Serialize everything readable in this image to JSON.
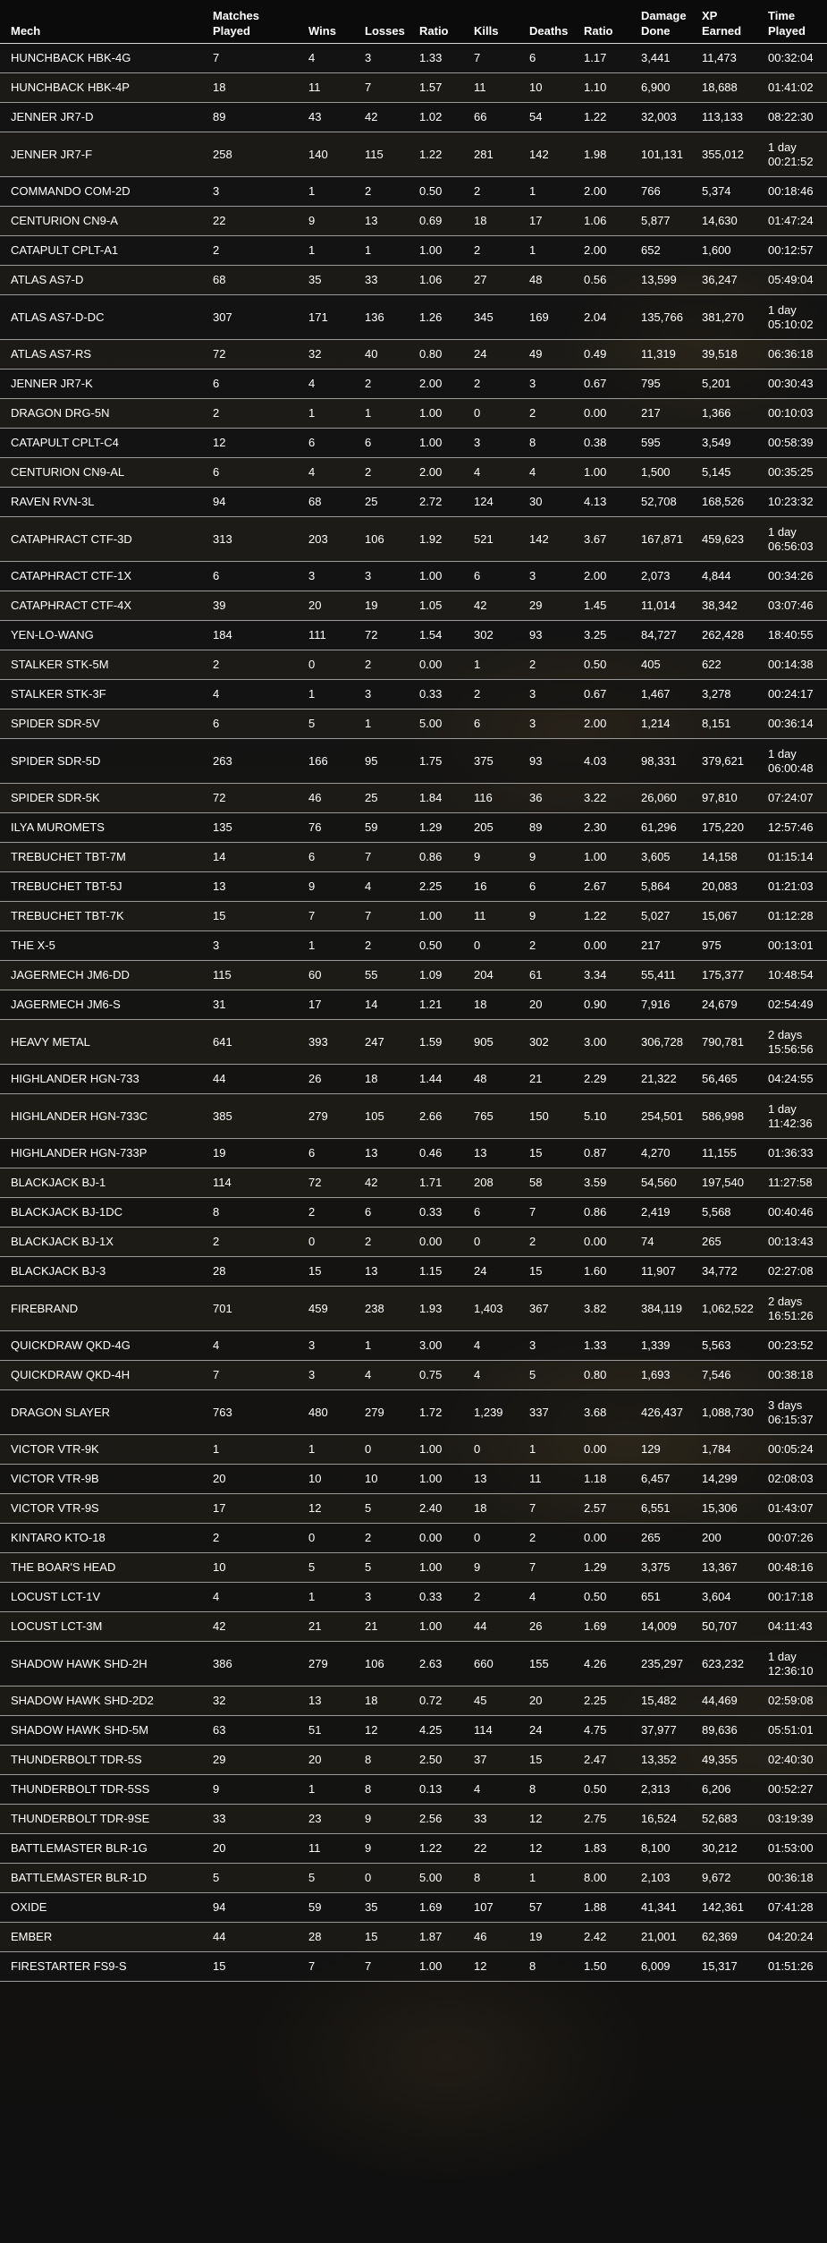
{
  "columns": [
    "Mech",
    "Matches\nPlayed",
    "Wins",
    "Losses",
    "Ratio",
    "Kills",
    "Deaths",
    "Ratio",
    "Damage\nDone",
    "XP\nEarned",
    "Time\nPlayed"
  ],
  "rows": [
    [
      "HUNCHBACK HBK-4G",
      "7",
      "4",
      "3",
      "1.33",
      "7",
      "6",
      "1.17",
      "3,441",
      "11,473",
      "00:32:04"
    ],
    [
      "HUNCHBACK HBK-4P",
      "18",
      "11",
      "7",
      "1.57",
      "11",
      "10",
      "1.10",
      "6,900",
      "18,688",
      "01:41:02"
    ],
    [
      "JENNER JR7-D",
      "89",
      "43",
      "42",
      "1.02",
      "66",
      "54",
      "1.22",
      "32,003",
      "113,133",
      "08:22:30"
    ],
    [
      "JENNER JR7-F",
      "258",
      "140",
      "115",
      "1.22",
      "281",
      "142",
      "1.98",
      "101,131",
      "355,012",
      "1 day 00:21:52"
    ],
    [
      "COMMANDO COM-2D",
      "3",
      "1",
      "2",
      "0.50",
      "2",
      "1",
      "2.00",
      "766",
      "5,374",
      "00:18:46"
    ],
    [
      "CENTURION CN9-A",
      "22",
      "9",
      "13",
      "0.69",
      "18",
      "17",
      "1.06",
      "5,877",
      "14,630",
      "01:47:24"
    ],
    [
      "CATAPULT CPLT-A1",
      "2",
      "1",
      "1",
      "1.00",
      "2",
      "1",
      "2.00",
      "652",
      "1,600",
      "00:12:57"
    ],
    [
      "ATLAS AS7-D",
      "68",
      "35",
      "33",
      "1.06",
      "27",
      "48",
      "0.56",
      "13,599",
      "36,247",
      "05:49:04"
    ],
    [
      "ATLAS AS7-D-DC",
      "307",
      "171",
      "136",
      "1.26",
      "345",
      "169",
      "2.04",
      "135,766",
      "381,270",
      "1 day 05:10:02"
    ],
    [
      "ATLAS AS7-RS",
      "72",
      "32",
      "40",
      "0.80",
      "24",
      "49",
      "0.49",
      "11,319",
      "39,518",
      "06:36:18"
    ],
    [
      "JENNER JR7-K",
      "6",
      "4",
      "2",
      "2.00",
      "2",
      "3",
      "0.67",
      "795",
      "5,201",
      "00:30:43"
    ],
    [
      "DRAGON DRG-5N",
      "2",
      "1",
      "1",
      "1.00",
      "0",
      "2",
      "0.00",
      "217",
      "1,366",
      "00:10:03"
    ],
    [
      "CATAPULT CPLT-C4",
      "12",
      "6",
      "6",
      "1.00",
      "3",
      "8",
      "0.38",
      "595",
      "3,549",
      "00:58:39"
    ],
    [
      "CENTURION CN9-AL",
      "6",
      "4",
      "2",
      "2.00",
      "4",
      "4",
      "1.00",
      "1,500",
      "5,145",
      "00:35:25"
    ],
    [
      "RAVEN RVN-3L",
      "94",
      "68",
      "25",
      "2.72",
      "124",
      "30",
      "4.13",
      "52,708",
      "168,526",
      "10:23:32"
    ],
    [
      "CATAPHRACT CTF-3D",
      "313",
      "203",
      "106",
      "1.92",
      "521",
      "142",
      "3.67",
      "167,871",
      "459,623",
      "1 day 06:56:03"
    ],
    [
      "CATAPHRACT CTF-1X",
      "6",
      "3",
      "3",
      "1.00",
      "6",
      "3",
      "2.00",
      "2,073",
      "4,844",
      "00:34:26"
    ],
    [
      "CATAPHRACT CTF-4X",
      "39",
      "20",
      "19",
      "1.05",
      "42",
      "29",
      "1.45",
      "11,014",
      "38,342",
      "03:07:46"
    ],
    [
      "YEN-LO-WANG",
      "184",
      "111",
      "72",
      "1.54",
      "302",
      "93",
      "3.25",
      "84,727",
      "262,428",
      "18:40:55"
    ],
    [
      "STALKER STK-5M",
      "2",
      "0",
      "2",
      "0.00",
      "1",
      "2",
      "0.50",
      "405",
      "622",
      "00:14:38"
    ],
    [
      "STALKER STK-3F",
      "4",
      "1",
      "3",
      "0.33",
      "2",
      "3",
      "0.67",
      "1,467",
      "3,278",
      "00:24:17"
    ],
    [
      "SPIDER SDR-5V",
      "6",
      "5",
      "1",
      "5.00",
      "6",
      "3",
      "2.00",
      "1,214",
      "8,151",
      "00:36:14"
    ],
    [
      "SPIDER SDR-5D",
      "263",
      "166",
      "95",
      "1.75",
      "375",
      "93",
      "4.03",
      "98,331",
      "379,621",
      "1 day 06:00:48"
    ],
    [
      "SPIDER SDR-5K",
      "72",
      "46",
      "25",
      "1.84",
      "116",
      "36",
      "3.22",
      "26,060",
      "97,810",
      "07:24:07"
    ],
    [
      "ILYA MUROMETS",
      "135",
      "76",
      "59",
      "1.29",
      "205",
      "89",
      "2.30",
      "61,296",
      "175,220",
      "12:57:46"
    ],
    [
      "TREBUCHET TBT-7M",
      "14",
      "6",
      "7",
      "0.86",
      "9",
      "9",
      "1.00",
      "3,605",
      "14,158",
      "01:15:14"
    ],
    [
      "TREBUCHET TBT-5J",
      "13",
      "9",
      "4",
      "2.25",
      "16",
      "6",
      "2.67",
      "5,864",
      "20,083",
      "01:21:03"
    ],
    [
      "TREBUCHET TBT-7K",
      "15",
      "7",
      "7",
      "1.00",
      "11",
      "9",
      "1.22",
      "5,027",
      "15,067",
      "01:12:28"
    ],
    [
      "THE X-5",
      "3",
      "1",
      "2",
      "0.50",
      "0",
      "2",
      "0.00",
      "217",
      "975",
      "00:13:01"
    ],
    [
      "JAGERMECH JM6-DD",
      "115",
      "60",
      "55",
      "1.09",
      "204",
      "61",
      "3.34",
      "55,411",
      "175,377",
      "10:48:54"
    ],
    [
      "JAGERMECH JM6-S",
      "31",
      "17",
      "14",
      "1.21",
      "18",
      "20",
      "0.90",
      "7,916",
      "24,679",
      "02:54:49"
    ],
    [
      "HEAVY METAL",
      "641",
      "393",
      "247",
      "1.59",
      "905",
      "302",
      "3.00",
      "306,728",
      "790,781",
      "2 days 15:56:56"
    ],
    [
      "HIGHLANDER HGN-733",
      "44",
      "26",
      "18",
      "1.44",
      "48",
      "21",
      "2.29",
      "21,322",
      "56,465",
      "04:24:55"
    ],
    [
      "HIGHLANDER HGN-733C",
      "385",
      "279",
      "105",
      "2.66",
      "765",
      "150",
      "5.10",
      "254,501",
      "586,998",
      "1 day 11:42:36"
    ],
    [
      "HIGHLANDER HGN-733P",
      "19",
      "6",
      "13",
      "0.46",
      "13",
      "15",
      "0.87",
      "4,270",
      "11,155",
      "01:36:33"
    ],
    [
      "BLACKJACK BJ-1",
      "114",
      "72",
      "42",
      "1.71",
      "208",
      "58",
      "3.59",
      "54,560",
      "197,540",
      "11:27:58"
    ],
    [
      "BLACKJACK BJ-1DC",
      "8",
      "2",
      "6",
      "0.33",
      "6",
      "7",
      "0.86",
      "2,419",
      "5,568",
      "00:40:46"
    ],
    [
      "BLACKJACK BJ-1X",
      "2",
      "0",
      "2",
      "0.00",
      "0",
      "2",
      "0.00",
      "74",
      "265",
      "00:13:43"
    ],
    [
      "BLACKJACK BJ-3",
      "28",
      "15",
      "13",
      "1.15",
      "24",
      "15",
      "1.60",
      "11,907",
      "34,772",
      "02:27:08"
    ],
    [
      "FIREBRAND",
      "701",
      "459",
      "238",
      "1.93",
      "1,403",
      "367",
      "3.82",
      "384,119",
      "1,062,522",
      "2 days 16:51:26"
    ],
    [
      "QUICKDRAW QKD-4G",
      "4",
      "3",
      "1",
      "3.00",
      "4",
      "3",
      "1.33",
      "1,339",
      "5,563",
      "00:23:52"
    ],
    [
      "QUICKDRAW QKD-4H",
      "7",
      "3",
      "4",
      "0.75",
      "4",
      "5",
      "0.80",
      "1,693",
      "7,546",
      "00:38:18"
    ],
    [
      "DRAGON SLAYER",
      "763",
      "480",
      "279",
      "1.72",
      "1,239",
      "337",
      "3.68",
      "426,437",
      "1,088,730",
      "3 days 06:15:37"
    ],
    [
      "VICTOR VTR-9K",
      "1",
      "1",
      "0",
      "1.00",
      "0",
      "1",
      "0.00",
      "129",
      "1,784",
      "00:05:24"
    ],
    [
      "VICTOR VTR-9B",
      "20",
      "10",
      "10",
      "1.00",
      "13",
      "11",
      "1.18",
      "6,457",
      "14,299",
      "02:08:03"
    ],
    [
      "VICTOR VTR-9S",
      "17",
      "12",
      "5",
      "2.40",
      "18",
      "7",
      "2.57",
      "6,551",
      "15,306",
      "01:43:07"
    ],
    [
      "KINTARO KTO-18",
      "2",
      "0",
      "2",
      "0.00",
      "0",
      "2",
      "0.00",
      "265",
      "200",
      "00:07:26"
    ],
    [
      "THE BOAR'S HEAD",
      "10",
      "5",
      "5",
      "1.00",
      "9",
      "7",
      "1.29",
      "3,375",
      "13,367",
      "00:48:16"
    ],
    [
      "LOCUST LCT-1V",
      "4",
      "1",
      "3",
      "0.33",
      "2",
      "4",
      "0.50",
      "651",
      "3,604",
      "00:17:18"
    ],
    [
      "LOCUST LCT-3M",
      "42",
      "21",
      "21",
      "1.00",
      "44",
      "26",
      "1.69",
      "14,009",
      "50,707",
      "04:11:43"
    ],
    [
      "SHADOW HAWK SHD-2H",
      "386",
      "279",
      "106",
      "2.63",
      "660",
      "155",
      "4.26",
      "235,297",
      "623,232",
      "1 day 12:36:10"
    ],
    [
      "SHADOW HAWK SHD-2D2",
      "32",
      "13",
      "18",
      "0.72",
      "45",
      "20",
      "2.25",
      "15,482",
      "44,469",
      "02:59:08"
    ],
    [
      "SHADOW HAWK SHD-5M",
      "63",
      "51",
      "12",
      "4.25",
      "114",
      "24",
      "4.75",
      "37,977",
      "89,636",
      "05:51:01"
    ],
    [
      "THUNDERBOLT TDR-5S",
      "29",
      "20",
      "8",
      "2.50",
      "37",
      "15",
      "2.47",
      "13,352",
      "49,355",
      "02:40:30"
    ],
    [
      "THUNDERBOLT TDR-5SS",
      "9",
      "1",
      "8",
      "0.13",
      "4",
      "8",
      "0.50",
      "2,313",
      "6,206",
      "00:52:27"
    ],
    [
      "THUNDERBOLT TDR-9SE",
      "33",
      "23",
      "9",
      "2.56",
      "33",
      "12",
      "2.75",
      "16,524",
      "52,683",
      "03:19:39"
    ],
    [
      "BATTLEMASTER BLR-1G",
      "20",
      "11",
      "9",
      "1.22",
      "22",
      "12",
      "1.83",
      "8,100",
      "30,212",
      "01:53:00"
    ],
    [
      "BATTLEMASTER BLR-1D",
      "5",
      "5",
      "0",
      "5.00",
      "8",
      "1",
      "8.00",
      "2,103",
      "9,672",
      "00:36:18"
    ],
    [
      "OXIDE",
      "94",
      "59",
      "35",
      "1.69",
      "107",
      "57",
      "1.88",
      "41,341",
      "142,361",
      "07:41:28"
    ],
    [
      "EMBER",
      "44",
      "28",
      "15",
      "1.87",
      "46",
      "19",
      "2.42",
      "21,001",
      "62,369",
      "04:20:24"
    ],
    [
      "FIRESTARTER FS9-S",
      "15",
      "7",
      "7",
      "1.00",
      "12",
      "8",
      "1.50",
      "6,009",
      "15,317",
      "01:51:26"
    ]
  ]
}
